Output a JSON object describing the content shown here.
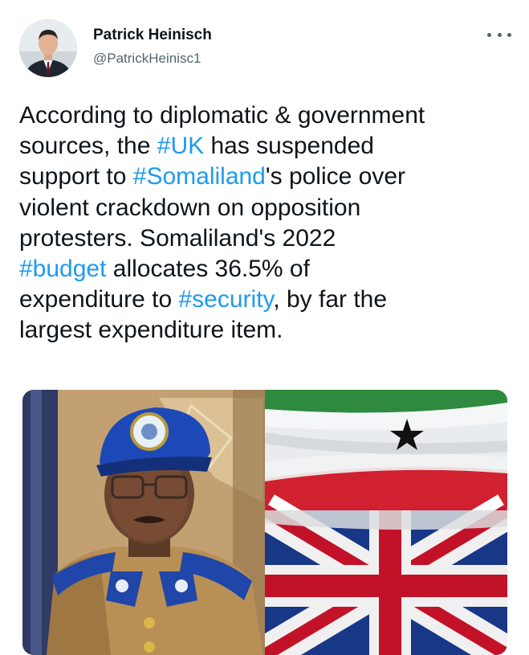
{
  "author": {
    "name": "Patrick Heinisch",
    "handle": "@PatrickHeinisc1"
  },
  "more_icon": "more-horizontal-icon",
  "tweet": {
    "l1": "According to diplomatic & government",
    "l2a": "sources, the ",
    "l2tag": "#UK",
    "l2b": " has suspended",
    "l3a": "support to ",
    "l3tag": "#Somaliland",
    "l3b": "'s police over",
    "l4": "violent crackdown on opposition",
    "l5": "protesters. Somaliland's 2022",
    "l6tag": "#budget",
    "l6b": " allocates 36.5% of",
    "l7a": "expenditure to ",
    "l7tag": "#security",
    "l7b": ", by far the",
    "l8": "largest expenditure item."
  },
  "colors": {
    "hashtag": "#1d9bf0",
    "text": "#0f1419",
    "secondary": "#536471"
  }
}
